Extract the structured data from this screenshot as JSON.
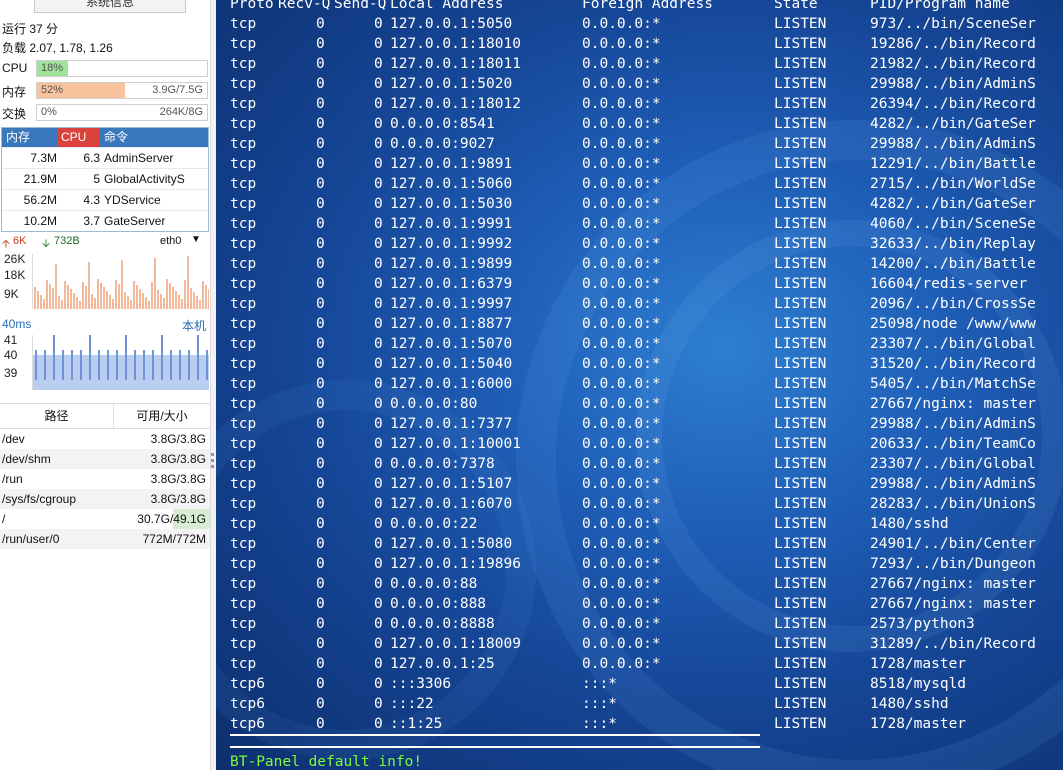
{
  "side": {
    "sysinfo_button": "系统信息",
    "uptime": "运行 37 分",
    "load": "负载 2.07, 1.78, 1.26",
    "meters": [
      {
        "label": "CPU",
        "pct": "18%",
        "value": "",
        "fill_fraction": 0.18,
        "color": "#9fe29a"
      },
      {
        "label": "内存",
        "pct": "52%",
        "value": "3.9G/7.5G",
        "fill_fraction": 0.52,
        "color": "#f8c39d"
      },
      {
        "label": "交换",
        "pct": "0%",
        "value": "264K/8G",
        "fill_fraction": 0.0,
        "color": "#9fe29a"
      }
    ],
    "proc_table": {
      "headers": [
        "内存",
        "CPU",
        "命令"
      ],
      "header_colors": [
        "#3a78bd",
        "#d9433c",
        "#3a78bd"
      ],
      "rows": [
        {
          "mem": "7.3M",
          "cpu": "6.3",
          "cmd": "AdminServer"
        },
        {
          "mem": "21.9M",
          "cpu": "5",
          "cmd": "GlobalActivityS"
        },
        {
          "mem": "56.2M",
          "cpu": "4.3",
          "cmd": "YDService"
        },
        {
          "mem": "10.2M",
          "cpu": "3.7",
          "cmd": "GateServer"
        }
      ]
    },
    "network": {
      "up": "6K",
      "down": "732B",
      "iface": "eth0",
      "y_labels": [
        "26K",
        "18K",
        "9K"
      ],
      "latency": "40ms",
      "host": "本机",
      "latency_labels": [
        "41",
        "40",
        "39"
      ]
    },
    "disk": {
      "headers": [
        "路径",
        "可用/大小"
      ],
      "rows": [
        {
          "path": "/dev",
          "size": "3.8G/3.8G"
        },
        {
          "path": "/dev/shm",
          "size": "3.8G/3.8G"
        },
        {
          "path": "/run",
          "size": "3.8G/3.8G"
        },
        {
          "path": "/sys/fs/cgroup",
          "size": "3.8G/3.8G"
        },
        {
          "path": "/",
          "size": "30.7G/49.1G"
        },
        {
          "path": "/run/user/0",
          "size": "772M/772M"
        }
      ]
    }
  },
  "terminal": {
    "header": {
      "proto": "Proto",
      "recvq": "Recv-Q",
      "sendq": "Send-Q",
      "local": "Local Address",
      "foreign": "Foreign Address",
      "state": "State",
      "prog": "PID/Program name"
    },
    "rows": [
      {
        "proto": "tcp",
        "recvq": "0",
        "sendq": "0",
        "local": "127.0.0.1:5050",
        "foreign": "0.0.0.0:*",
        "state": "LISTEN",
        "prog": "973/../bin/SceneSer"
      },
      {
        "proto": "tcp",
        "recvq": "0",
        "sendq": "0",
        "local": "127.0.0.1:18010",
        "foreign": "0.0.0.0:*",
        "state": "LISTEN",
        "prog": "19286/../bin/Record"
      },
      {
        "proto": "tcp",
        "recvq": "0",
        "sendq": "0",
        "local": "127.0.0.1:18011",
        "foreign": "0.0.0.0:*",
        "state": "LISTEN",
        "prog": "21982/../bin/Record"
      },
      {
        "proto": "tcp",
        "recvq": "0",
        "sendq": "0",
        "local": "127.0.0.1:5020",
        "foreign": "0.0.0.0:*",
        "state": "LISTEN",
        "prog": "29988/../bin/AdminS"
      },
      {
        "proto": "tcp",
        "recvq": "0",
        "sendq": "0",
        "local": "127.0.0.1:18012",
        "foreign": "0.0.0.0:*",
        "state": "LISTEN",
        "prog": "26394/../bin/Record"
      },
      {
        "proto": "tcp",
        "recvq": "0",
        "sendq": "0",
        "local": "0.0.0.0:8541",
        "foreign": "0.0.0.0:*",
        "state": "LISTEN",
        "prog": "4282/../bin/GateSer"
      },
      {
        "proto": "tcp",
        "recvq": "0",
        "sendq": "0",
        "local": "0.0.0.0:9027",
        "foreign": "0.0.0.0:*",
        "state": "LISTEN",
        "prog": "29988/../bin/AdminS"
      },
      {
        "proto": "tcp",
        "recvq": "0",
        "sendq": "0",
        "local": "127.0.0.1:9891",
        "foreign": "0.0.0.0:*",
        "state": "LISTEN",
        "prog": "12291/../bin/Battle"
      },
      {
        "proto": "tcp",
        "recvq": "0",
        "sendq": "0",
        "local": "127.0.0.1:5060",
        "foreign": "0.0.0.0:*",
        "state": "LISTEN",
        "prog": "2715/../bin/WorldSe"
      },
      {
        "proto": "tcp",
        "recvq": "0",
        "sendq": "0",
        "local": "127.0.0.1:5030",
        "foreign": "0.0.0.0:*",
        "state": "LISTEN",
        "prog": "4282/../bin/GateSer"
      },
      {
        "proto": "tcp",
        "recvq": "0",
        "sendq": "0",
        "local": "127.0.0.1:9991",
        "foreign": "0.0.0.0:*",
        "state": "LISTEN",
        "prog": "4060/../bin/SceneSe"
      },
      {
        "proto": "tcp",
        "recvq": "0",
        "sendq": "0",
        "local": "127.0.0.1:9992",
        "foreign": "0.0.0.0:*",
        "state": "LISTEN",
        "prog": "32633/../bin/Replay"
      },
      {
        "proto": "tcp",
        "recvq": "0",
        "sendq": "0",
        "local": "127.0.0.1:9899",
        "foreign": "0.0.0.0:*",
        "state": "LISTEN",
        "prog": "14200/../bin/Battle"
      },
      {
        "proto": "tcp",
        "recvq": "0",
        "sendq": "0",
        "local": "127.0.0.1:6379",
        "foreign": "0.0.0.0:*",
        "state": "LISTEN",
        "prog": "16604/redis-server"
      },
      {
        "proto": "tcp",
        "recvq": "0",
        "sendq": "0",
        "local": "127.0.0.1:9997",
        "foreign": "0.0.0.0:*",
        "state": "LISTEN",
        "prog": "2096/../bin/CrossSe"
      },
      {
        "proto": "tcp",
        "recvq": "0",
        "sendq": "0",
        "local": "127.0.0.1:8877",
        "foreign": "0.0.0.0:*",
        "state": "LISTEN",
        "prog": "25098/node /www/www"
      },
      {
        "proto": "tcp",
        "recvq": "0",
        "sendq": "0",
        "local": "127.0.0.1:5070",
        "foreign": "0.0.0.0:*",
        "state": "LISTEN",
        "prog": "23307/../bin/Global"
      },
      {
        "proto": "tcp",
        "recvq": "0",
        "sendq": "0",
        "local": "127.0.0.1:5040",
        "foreign": "0.0.0.0:*",
        "state": "LISTEN",
        "prog": "31520/../bin/Record"
      },
      {
        "proto": "tcp",
        "recvq": "0",
        "sendq": "0",
        "local": "127.0.0.1:6000",
        "foreign": "0.0.0.0:*",
        "state": "LISTEN",
        "prog": "5405/../bin/MatchSe"
      },
      {
        "proto": "tcp",
        "recvq": "0",
        "sendq": "0",
        "local": "0.0.0.0:80",
        "foreign": "0.0.0.0:*",
        "state": "LISTEN",
        "prog": "27667/nginx: master"
      },
      {
        "proto": "tcp",
        "recvq": "0",
        "sendq": "0",
        "local": "127.0.0.1:7377",
        "foreign": "0.0.0.0:*",
        "state": "LISTEN",
        "prog": "29988/../bin/AdminS"
      },
      {
        "proto": "tcp",
        "recvq": "0",
        "sendq": "0",
        "local": "127.0.0.1:10001",
        "foreign": "0.0.0.0:*",
        "state": "LISTEN",
        "prog": "20633/../bin/TeamCo"
      },
      {
        "proto": "tcp",
        "recvq": "0",
        "sendq": "0",
        "local": "0.0.0.0:7378",
        "foreign": "0.0.0.0:*",
        "state": "LISTEN",
        "prog": "23307/../bin/Global"
      },
      {
        "proto": "tcp",
        "recvq": "0",
        "sendq": "0",
        "local": "127.0.0.1:5107",
        "foreign": "0.0.0.0:*",
        "state": "LISTEN",
        "prog": "29988/../bin/AdminS"
      },
      {
        "proto": "tcp",
        "recvq": "0",
        "sendq": "0",
        "local": "127.0.0.1:6070",
        "foreign": "0.0.0.0:*",
        "state": "LISTEN",
        "prog": "28283/../bin/UnionS"
      },
      {
        "proto": "tcp",
        "recvq": "0",
        "sendq": "0",
        "local": "0.0.0.0:22",
        "foreign": "0.0.0.0:*",
        "state": "LISTEN",
        "prog": "1480/sshd"
      },
      {
        "proto": "tcp",
        "recvq": "0",
        "sendq": "0",
        "local": "127.0.0.1:5080",
        "foreign": "0.0.0.0:*",
        "state": "LISTEN",
        "prog": "24901/../bin/Center"
      },
      {
        "proto": "tcp",
        "recvq": "0",
        "sendq": "0",
        "local": "127.0.0.1:19896",
        "foreign": "0.0.0.0:*",
        "state": "LISTEN",
        "prog": "7293/../bin/Dungeon"
      },
      {
        "proto": "tcp",
        "recvq": "0",
        "sendq": "0",
        "local": "0.0.0.0:88",
        "foreign": "0.0.0.0:*",
        "state": "LISTEN",
        "prog": "27667/nginx: master"
      },
      {
        "proto": "tcp",
        "recvq": "0",
        "sendq": "0",
        "local": "0.0.0.0:888",
        "foreign": "0.0.0.0:*",
        "state": "LISTEN",
        "prog": "27667/nginx: master"
      },
      {
        "proto": "tcp",
        "recvq": "0",
        "sendq": "0",
        "local": "0.0.0.0:8888",
        "foreign": "0.0.0.0:*",
        "state": "LISTEN",
        "prog": "2573/python3"
      },
      {
        "proto": "tcp",
        "recvq": "0",
        "sendq": "0",
        "local": "127.0.0.1:18009",
        "foreign": "0.0.0.0:*",
        "state": "LISTEN",
        "prog": "31289/../bin/Record"
      },
      {
        "proto": "tcp",
        "recvq": "0",
        "sendq": "0",
        "local": "127.0.0.1:25",
        "foreign": "0.0.0.0:*",
        "state": "LISTEN",
        "prog": "1728/master"
      },
      {
        "proto": "tcp6",
        "recvq": "0",
        "sendq": "0",
        "local": ":::3306",
        "foreign": ":::*",
        "state": "LISTEN",
        "prog": "8518/mysqld"
      },
      {
        "proto": "tcp6",
        "recvq": "0",
        "sendq": "0",
        "local": ":::22",
        "foreign": ":::*",
        "state": "LISTEN",
        "prog": "1480/sshd"
      },
      {
        "proto": "tcp6",
        "recvq": "0",
        "sendq": "0",
        "local": "::1:25",
        "foreign": ":::*",
        "state": "LISTEN",
        "prog": "1728/master"
      }
    ],
    "footer": "BT-Panel default info!"
  }
}
